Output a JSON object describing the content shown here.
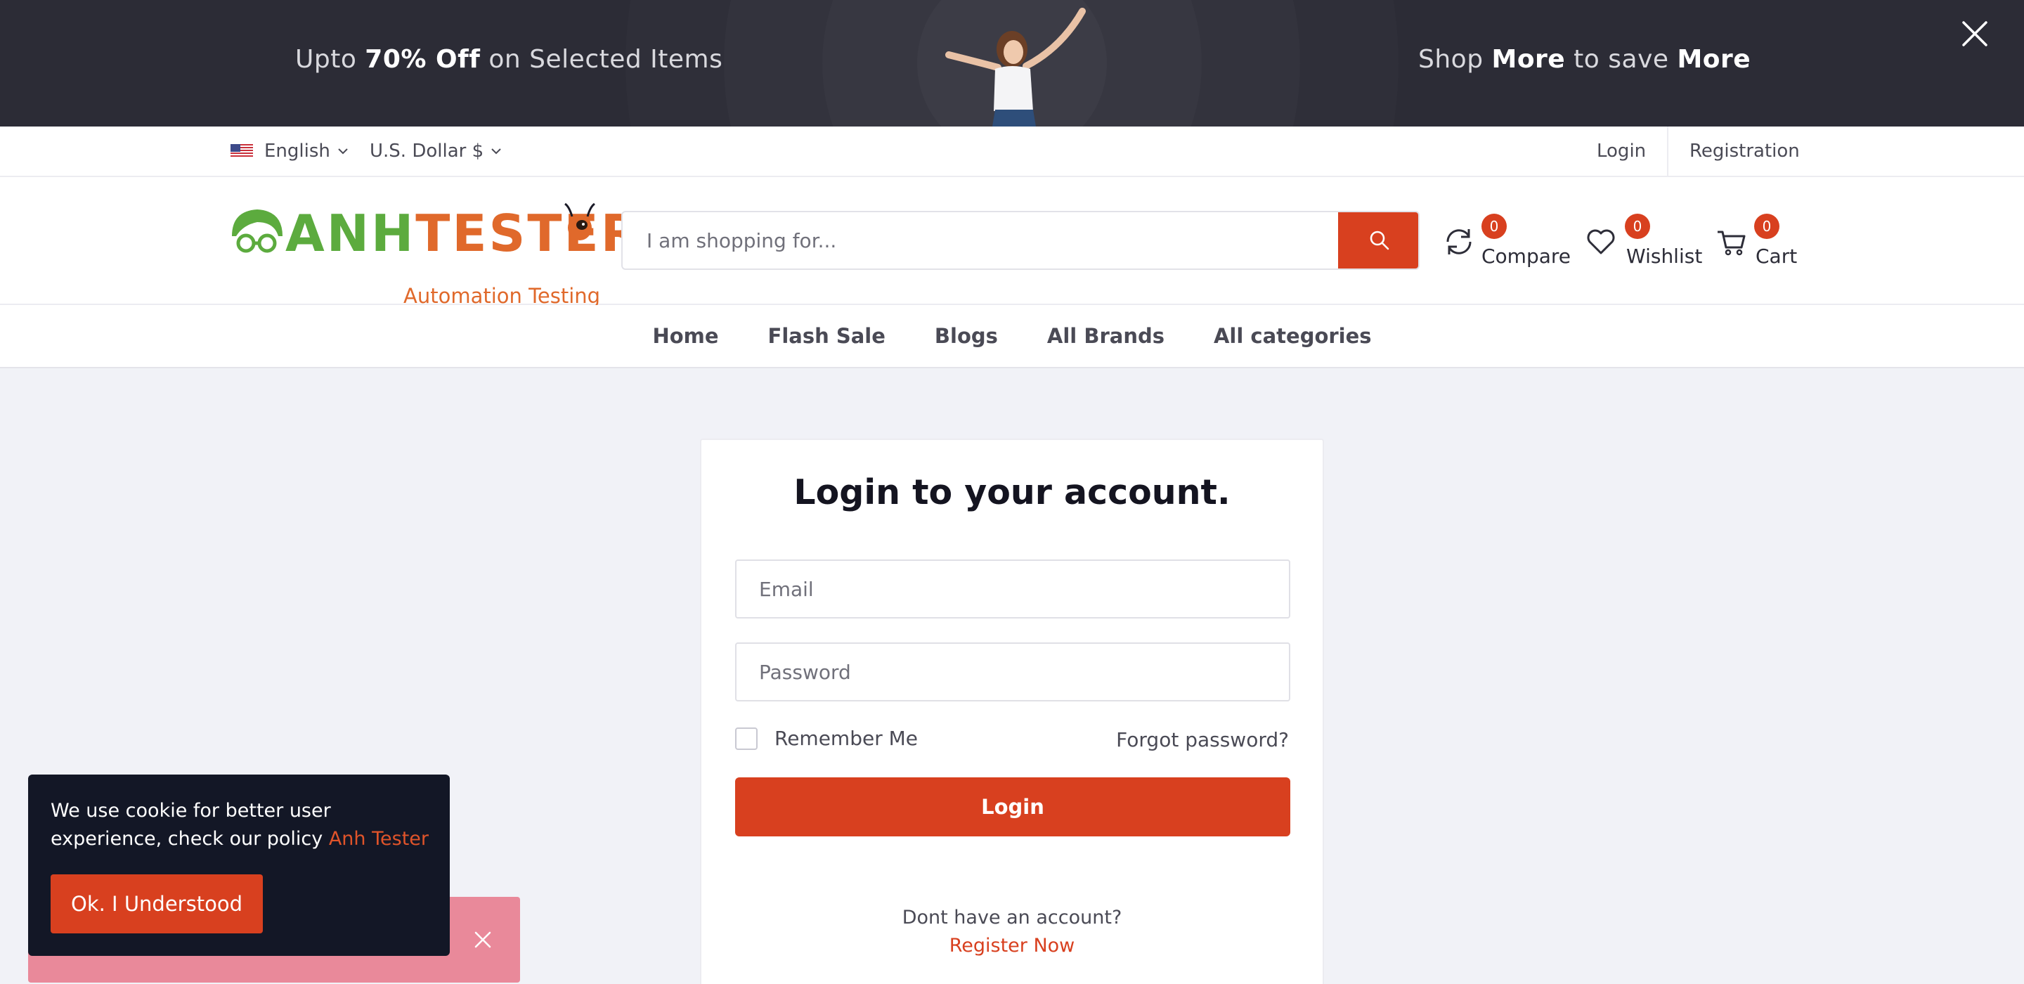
{
  "promo": {
    "left_pre": "Upto ",
    "left_bold": "70% Off",
    "left_post": " on Selected Items",
    "right_pre": "Shop ",
    "right_bold1": "More",
    "right_mid": " to save ",
    "right_bold2": "More",
    "close_icon": "close-icon"
  },
  "topbar": {
    "language": "English",
    "currency": "U.S. Dollar $",
    "login": "Login",
    "registration": "Registration"
  },
  "header": {
    "logo_green": "ANH",
    "logo_orange": "TESTER",
    "logo_sub": "Automation Testing",
    "search_placeholder": "I am shopping for...",
    "compare": {
      "label": "Compare",
      "count": "0"
    },
    "wishlist": {
      "label": "Wishlist",
      "count": "0"
    },
    "cart": {
      "label": "Cart",
      "count": "0"
    }
  },
  "nav": {
    "items": [
      "Home",
      "Flash Sale",
      "Blogs",
      "All Brands",
      "All categories"
    ]
  },
  "login": {
    "title": "Login to your account.",
    "email_placeholder": "Email",
    "password_placeholder": "Password",
    "remember": "Remember Me",
    "forgot": "Forgot password?",
    "button": "Login",
    "no_account": "Dont have an account?",
    "register": "Register Now"
  },
  "cookie": {
    "text": "We use cookie for better user experience, check our policy ",
    "link": "Anh Tester",
    "button": "Ok. I Understood"
  },
  "colors": {
    "accent": "#d8401f",
    "banner": "#2c2c36",
    "logo_green": "#5cab3e",
    "logo_orange": "#e0692b"
  }
}
